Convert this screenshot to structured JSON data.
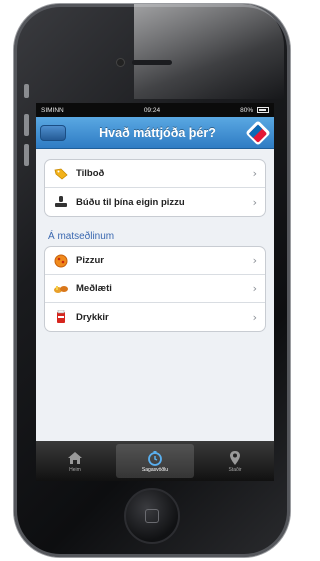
{
  "status_bar": {
    "carrier": "SIMINN",
    "time": "09:24",
    "battery": "80%"
  },
  "nav": {
    "back_label": "",
    "title": "Hvað máttjóða þér?",
    "logo_icon": "dominos-logo-icon"
  },
  "menu_top": [
    {
      "label": "Tilboð",
      "icon": "tag-icon"
    },
    {
      "label": "Búðu til þína eigin pizzu",
      "icon": "chef-icon"
    }
  ],
  "section_header": "Á matseðlinum",
  "menu_items": [
    {
      "label": "Pizzur",
      "icon": "pizza-icon"
    },
    {
      "label": "Meðlæti",
      "icon": "sides-icon"
    },
    {
      "label": "Drykkir",
      "icon": "drinks-icon"
    }
  ],
  "tab_bar": [
    {
      "label": "Heim",
      "icon": "home-icon",
      "active": false
    },
    {
      "label": "Sagasvöðlu",
      "icon": "clock-icon",
      "active": true
    },
    {
      "label": "Staðir",
      "icon": "map-pin-icon",
      "active": false
    }
  ],
  "colors": {
    "nav_blue": "#2f7cc4",
    "section_blue": "#3a68b0",
    "brand_red": "#e31837"
  }
}
